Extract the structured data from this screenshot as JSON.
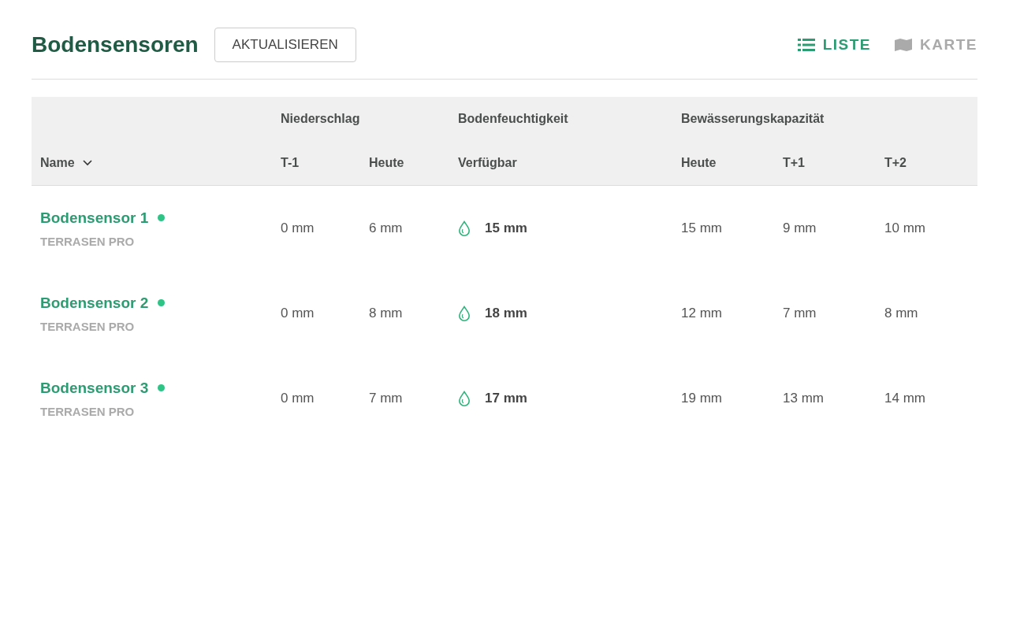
{
  "title": "Bodensensoren",
  "refresh_button": "AKTUALISIEREN",
  "views": [
    {
      "kind": "list",
      "label": "LISTE",
      "selected": true
    },
    {
      "kind": "map",
      "label": "KARTE",
      "selected": false
    }
  ],
  "table": {
    "name_column": "Name",
    "column_groups": [
      {
        "label": "Niederschlag",
        "columns": [
          "T-1",
          "Heute"
        ]
      },
      {
        "label": "Bodenfeuchtigkeit",
        "columns": [
          "Verfügbar"
        ]
      },
      {
        "label": "Bewässerungskapazität",
        "columns": [
          "Heute",
          "T+1",
          "T+2"
        ]
      }
    ],
    "rows": [
      {
        "name": "Bodensensor 1",
        "online": true,
        "model": "TERRASEN PRO",
        "cells": [
          "0 mm",
          "6 mm",
          "15 mm",
          "15 mm",
          "9 mm",
          "10 mm"
        ]
      },
      {
        "name": "Bodensensor 2",
        "online": true,
        "model": "TERRASEN PRO",
        "cells": [
          "0 mm",
          "8 mm",
          "18 mm",
          "12 mm",
          "7 mm",
          "8 mm"
        ]
      },
      {
        "name": "Bodensensor 3",
        "online": true,
        "model": "TERRASEN PRO",
        "cells": [
          "0 mm",
          "7 mm",
          "17 mm",
          "19 mm",
          "13 mm",
          "14 mm"
        ]
      }
    ]
  }
}
